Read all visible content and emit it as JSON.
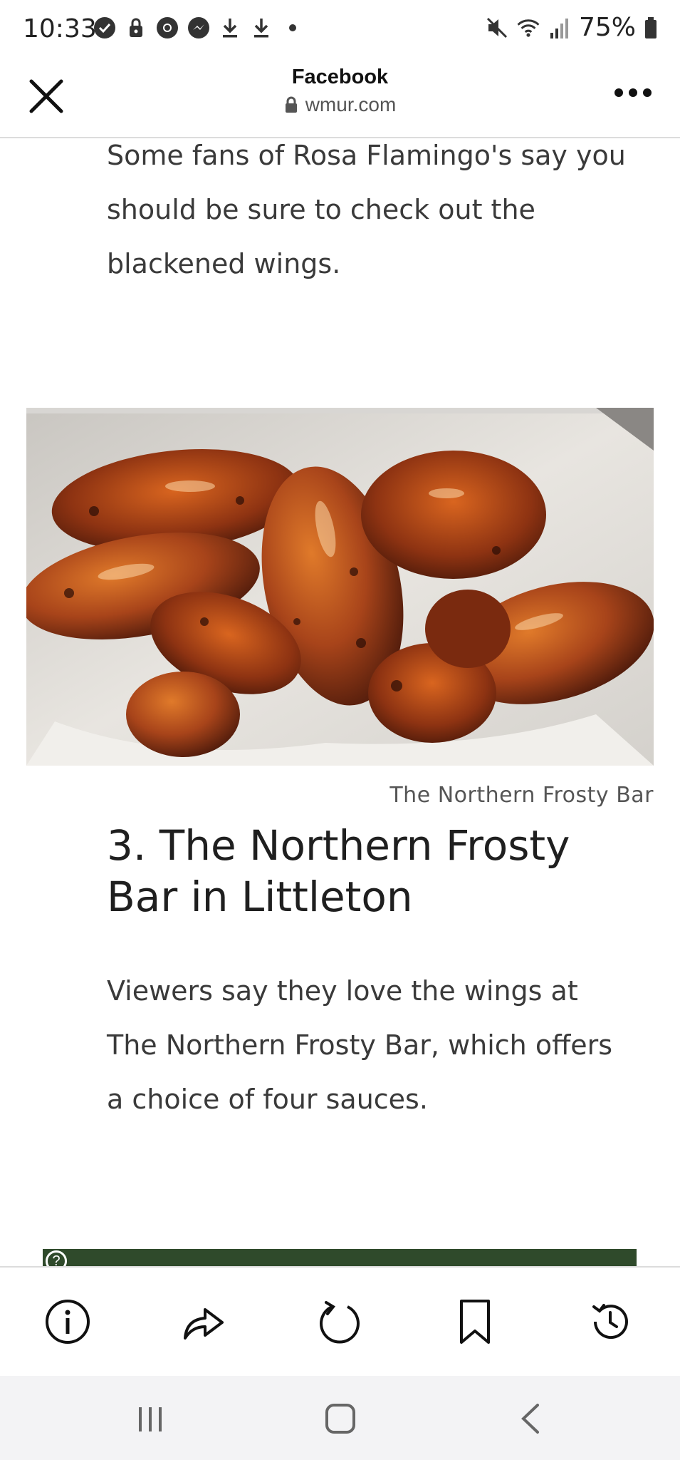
{
  "status_bar": {
    "time": "10:33",
    "battery": "75%",
    "left_icons": [
      "verified-icon",
      "lock-notification-icon",
      "chrome-icon",
      "messenger-icon",
      "download-icon",
      "download-icon",
      "dot-icon"
    ],
    "right_icons": [
      "mute-icon",
      "wifi-icon",
      "signal-icon",
      "battery-icon"
    ]
  },
  "browser": {
    "title": "Facebook",
    "url": "wmur.com"
  },
  "article": {
    "para_top": "Some fans of Rosa Flamingo's say you should be sure to check out the blackened wings.",
    "image_caption": "The Northern Frosty Bar",
    "heading": "3. The Northern Frosty Bar in Littleton",
    "para_bottom": "Viewers say they love the wings at The Northern Frosty Bar, which offers a choice of four sauces.",
    "map_help": "?"
  },
  "toolbar": {
    "items": [
      "info-icon",
      "share-icon",
      "refresh-icon",
      "bookmark-icon",
      "history-icon"
    ]
  },
  "colors": {
    "text": "#3a3a3a",
    "heading": "#1f1f1f",
    "caption": "#555555",
    "divider": "#dcdcdc",
    "nav_bg": "#f3f3f5"
  }
}
